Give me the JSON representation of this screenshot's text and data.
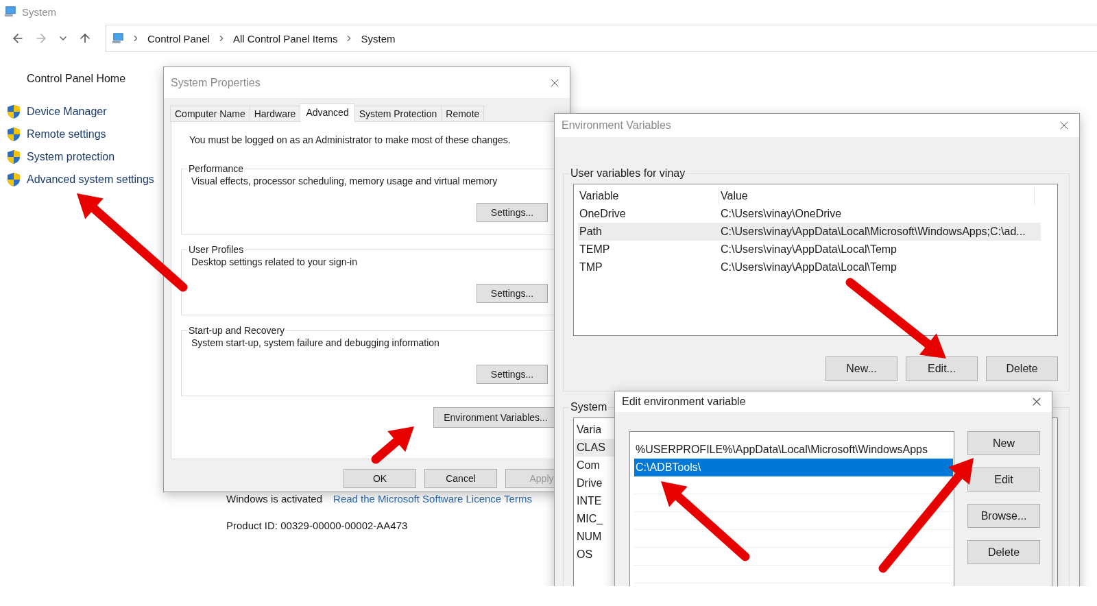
{
  "window": {
    "title": "System"
  },
  "nav": {
    "breadcrumb": [
      "Control Panel",
      "All Control Panel Items",
      "System"
    ]
  },
  "sidebar": {
    "home": "Control Panel Home",
    "items": [
      {
        "label": "Device Manager"
      },
      {
        "label": "Remote settings"
      },
      {
        "label": "System protection"
      },
      {
        "label": "Advanced system settings"
      }
    ]
  },
  "activation": {
    "status": "Windows is activated",
    "link": "Read the Microsoft Software Licence Terms"
  },
  "product_id": "Product ID: 00329-00000-00002-AA473",
  "system_properties": {
    "title": "System Properties",
    "tabs": [
      {
        "label": "Computer Name",
        "selected": false
      },
      {
        "label": "Hardware",
        "selected": false
      },
      {
        "label": "Advanced",
        "selected": true
      },
      {
        "label": "System Protection",
        "selected": false
      },
      {
        "label": "Remote",
        "selected": false
      }
    ],
    "notice": "You must be logged on as an Administrator to make most of these changes.",
    "groups": [
      {
        "title": "Performance",
        "description": "Visual effects, processor scheduling, memory usage and virtual memory",
        "button": "Settings..."
      },
      {
        "title": "User Profiles",
        "description": "Desktop settings related to your sign-in",
        "button": "Settings..."
      },
      {
        "title": "Start-up and Recovery",
        "description": "System start-up, system failure and debugging information",
        "button": "Settings..."
      }
    ],
    "env_button": "Environment Variables...",
    "buttons": [
      {
        "label": "OK",
        "disabled": false
      },
      {
        "label": "Cancel",
        "disabled": false
      },
      {
        "label": "Apply",
        "disabled": true
      }
    ]
  },
  "environment_variables": {
    "title": "Environment Variables",
    "user_group": {
      "title": "User variables for vinay",
      "columns": [
        "Variable",
        "Value"
      ],
      "rows": [
        {
          "variable": "OneDrive",
          "value": "C:\\Users\\vinay\\OneDrive",
          "selected": false
        },
        {
          "variable": "Path",
          "value": "C:\\Users\\vinay\\AppData\\Local\\Microsoft\\WindowsApps;C:\\ad...",
          "selected": true
        },
        {
          "variable": "TEMP",
          "value": "C:\\Users\\vinay\\AppData\\Local\\Temp",
          "selected": false
        },
        {
          "variable": "TMP",
          "value": "C:\\Users\\vinay\\AppData\\Local\\Temp",
          "selected": false
        }
      ],
      "buttons": [
        "New...",
        "Edit...",
        "Delete"
      ]
    },
    "system_group": {
      "title": "System",
      "header": "Varia",
      "rows": [
        {
          "text": "CLAS",
          "selected": true
        },
        {
          "text": "Com",
          "selected": false
        },
        {
          "text": "Drive",
          "selected": false
        },
        {
          "text": "INTE",
          "selected": false
        },
        {
          "text": "MIC_",
          "selected": false
        },
        {
          "text": "NUM",
          "selected": false
        },
        {
          "text": "OS",
          "selected": false
        }
      ]
    }
  },
  "edit_variable": {
    "title": "Edit environment variable",
    "entries": [
      {
        "text": "%USERPROFILE%\\AppData\\Local\\Microsoft\\WindowsApps",
        "selected": false
      },
      {
        "text": "C:\\ADBTools\\",
        "selected": true
      }
    ],
    "buttons": [
      "New",
      "Edit",
      "Browse...",
      "Delete"
    ]
  }
}
